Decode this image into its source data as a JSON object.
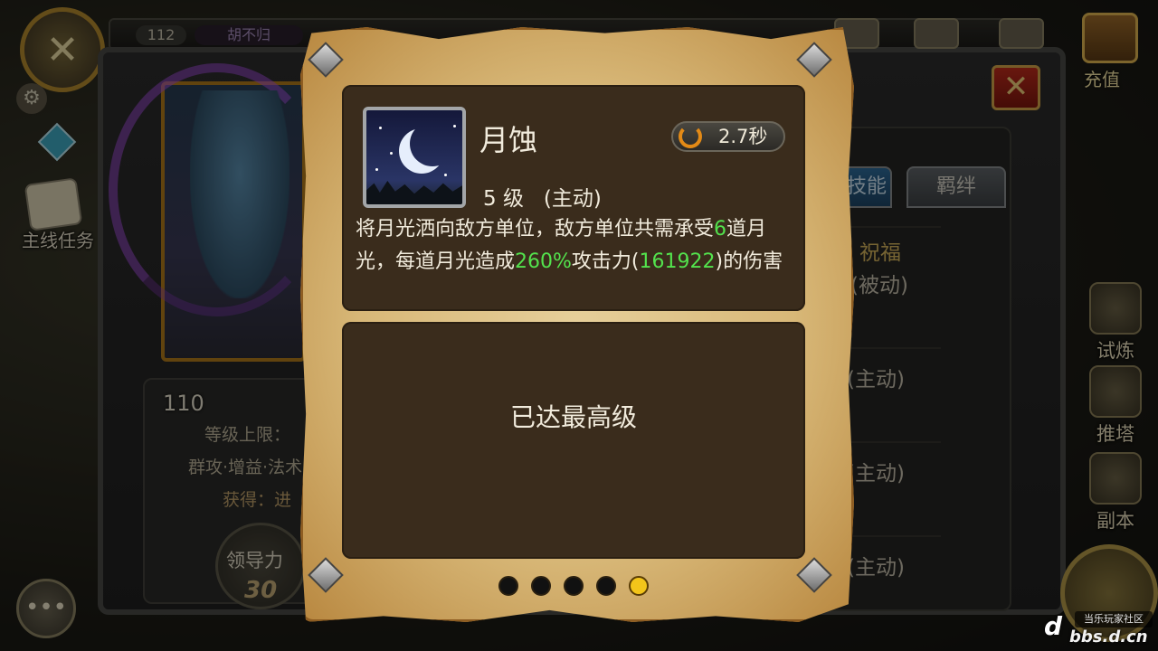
{
  "hud": {
    "player_level": "112",
    "player_name": "胡不归",
    "quest_label": "主线任务",
    "recharge_label": "充值",
    "chat_glyph": "•••"
  },
  "hero": {
    "level": "110",
    "level_cap_label": "等级上限：",
    "tags": "群攻·增益·法术",
    "obtain_label": "获得：进",
    "leadership_label": "领导力",
    "leadership_value": "30"
  },
  "right_panel": {
    "tabs": [
      "技能",
      "羁绊"
    ],
    "skills": [
      {
        "name": "祝福",
        "type": "(被动)"
      },
      {
        "name": "",
        "type": "(主动)"
      },
      {
        "name": "",
        "type": "(主动)"
      },
      {
        "name": "",
        "type": "(主动)"
      }
    ]
  },
  "side_nav": [
    {
      "label": "试炼",
      "icon": "portal-icon"
    },
    {
      "label": "推塔",
      "icon": "tower-icon"
    },
    {
      "label": "副本",
      "icon": "scroll-map-icon"
    }
  ],
  "popup": {
    "skill_name": "月蚀",
    "cooldown": "2.7秒",
    "level_line": "5 级   (主动)",
    "description_parts": [
      {
        "text": "将月光洒向敌方单位，敌方单位共需承受",
        "highlight": false
      },
      {
        "text": "6",
        "highlight": true
      },
      {
        "text": "道月光，每道月光造成",
        "highlight": false
      },
      {
        "text": "260%",
        "highlight": true
      },
      {
        "text": "攻击力(",
        "highlight": false
      },
      {
        "text": "161922",
        "highlight": true
      },
      {
        "text": ")的伤害",
        "highlight": false
      }
    ],
    "max_level_text": "已达最高级",
    "page_count": 5,
    "active_page": 5
  },
  "watermark": {
    "top": "当乐玩家社区",
    "bottom": "bbs.d.cn"
  },
  "colors": {
    "highlight_green": "#53e24d",
    "active_dot": "#f3c51a",
    "card_bg": "#3a2c1c",
    "close_red": "#bf2b1c"
  }
}
